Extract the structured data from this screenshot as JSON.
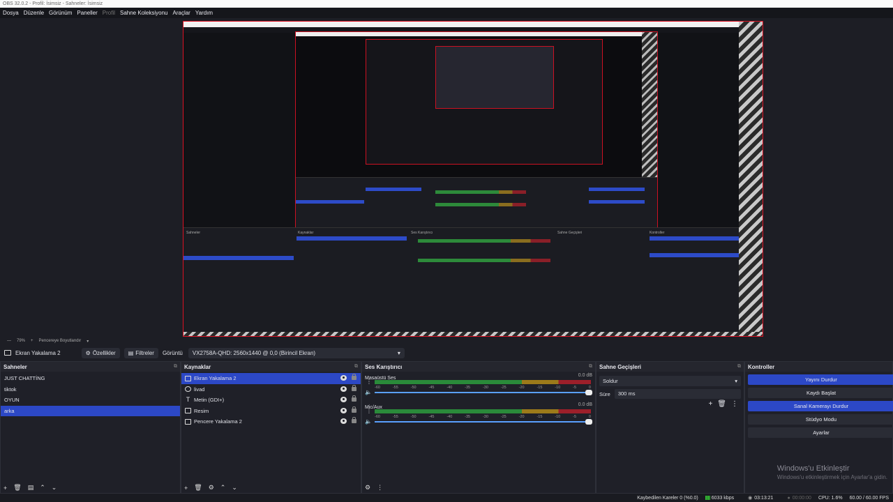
{
  "window": {
    "title": "OBS 32.0.2 - Profil: İsimsiz - Sahneler: İsimsiz"
  },
  "menu": [
    "Dosya",
    "Düzenle",
    "Görünüm",
    "Paneller",
    "Profil",
    "Sahne Koleksiyonu",
    "Araçlar",
    "Yardım"
  ],
  "preview_footer": {
    "zoom": "79%",
    "plus": "+",
    "resize_label": "Pencereye Boyutlandır"
  },
  "toolbar": {
    "source_name": "Ekran Yakalama 2",
    "properties_label": "Özellikler",
    "filters_label": "Filtreler",
    "display_label": "Görüntü",
    "display_value": "VX2758A-QHD: 2560x1440 @ 0,0 (Birincil Ekran)"
  },
  "scenes": {
    "title": "Sahneler",
    "items": [
      "JUST CHATTİNG",
      "tiktok",
      "OYUN",
      "arka"
    ],
    "selected_index": 3
  },
  "sources": {
    "title": "Kaynaklar",
    "items": [
      {
        "label": "Ekran Yakalama 2",
        "icon": "monitor-icon",
        "selected": true
      },
      {
        "label": "livad",
        "icon": "globe-icon",
        "selected": false
      },
      {
        "label": "Metin (GDI+)",
        "icon": "text-icon",
        "selected": false
      },
      {
        "label": "Resim",
        "icon": "image-icon",
        "selected": false
      },
      {
        "label": "Pencere Yakalama 2",
        "icon": "window-icon",
        "selected": false
      }
    ]
  },
  "mixer": {
    "title": "Ses Karıştırıcı",
    "tracks": [
      {
        "name": "Masaüstü Ses",
        "db": "0.0 dB",
        "volume_fraction": 1.0
      },
      {
        "name": "Mic/Aux",
        "db": "0.0 dB",
        "volume_fraction": 1.0
      }
    ],
    "ticks": [
      "-60",
      "-55",
      "-50",
      "-45",
      "-40",
      "-35",
      "-30",
      "-25",
      "-20",
      "-15",
      "-10",
      "-5",
      "0"
    ]
  },
  "transitions": {
    "title": "Sahne Geçişleri",
    "selected": "Soldur",
    "duration_label": "Süre",
    "duration_value": "300 ms"
  },
  "controls": {
    "title": "Kontroller",
    "buttons": [
      {
        "label": "Yayını Durdur",
        "active": true
      },
      {
        "label": "Kaydı Başlat",
        "active": false
      },
      {
        "label": "Sanal Kamerayı Durdur",
        "active": true
      },
      {
        "label": "Stüdyo Modu",
        "active": false
      },
      {
        "label": "Ayarlar",
        "active": false
      }
    ]
  },
  "watermark": {
    "line1": "Windows'u Etkinleştir",
    "line2": "Windows'u etkinleştirmek için Ayarlar'a gidin."
  },
  "status": {
    "dropped": "Kaybedilen Kareler 0 (%0.0)",
    "bitrate": "6033 kbps",
    "stream_time": "03:13:21",
    "rec_time": "00:00:00",
    "cpu": "CPU: 1.6%",
    "fps": "60.00 / 60.00 FPS"
  }
}
